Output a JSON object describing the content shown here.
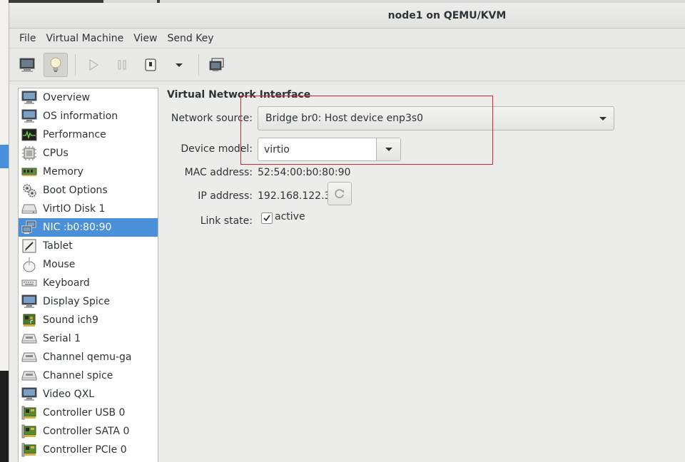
{
  "window": {
    "title": "node1 on QEMU/KVM"
  },
  "menubar": {
    "items": [
      "File",
      "Virtual Machine",
      "View",
      "Send Key"
    ]
  },
  "toolbar": {
    "buttons": [
      {
        "name": "console-icon",
        "active": false,
        "disabled": false
      },
      {
        "name": "details-icon",
        "active": true,
        "disabled": false
      },
      {
        "name": "run-icon",
        "active": false,
        "disabled": true
      },
      {
        "name": "pause-icon",
        "active": false,
        "disabled": true
      },
      {
        "name": "shutdown-icon",
        "active": false,
        "disabled": false
      },
      {
        "name": "shutdown-menu-icon",
        "active": false,
        "disabled": false
      },
      {
        "name": "fullscreen-icon",
        "active": false,
        "disabled": false
      }
    ]
  },
  "sidebar": {
    "items": [
      {
        "label": "Overview",
        "icon": "monitor-icon"
      },
      {
        "label": "OS information",
        "icon": "monitor-icon"
      },
      {
        "label": "Performance",
        "icon": "graph-icon"
      },
      {
        "label": "CPUs",
        "icon": "cpu-icon"
      },
      {
        "label": "Memory",
        "icon": "memory-icon"
      },
      {
        "label": "Boot Options",
        "icon": "gear-icon"
      },
      {
        "label": "VirtIO Disk 1",
        "icon": "disk-icon"
      },
      {
        "label": "NIC :b0:80:90",
        "icon": "network-icon",
        "selected": true
      },
      {
        "label": "Tablet",
        "icon": "tablet-icon"
      },
      {
        "label": "Mouse",
        "icon": "mouse-icon"
      },
      {
        "label": "Keyboard",
        "icon": "keyboard-icon"
      },
      {
        "label": "Display Spice",
        "icon": "monitor-icon"
      },
      {
        "label": "Sound ich9",
        "icon": "sound-card-icon"
      },
      {
        "label": "Serial 1",
        "icon": "serial-icon"
      },
      {
        "label": "Channel qemu-ga",
        "icon": "serial-icon"
      },
      {
        "label": "Channel spice",
        "icon": "serial-icon"
      },
      {
        "label": "Video QXL",
        "icon": "monitor-icon"
      },
      {
        "label": "Controller USB 0",
        "icon": "pci-card-icon"
      },
      {
        "label": "Controller SATA 0",
        "icon": "pci-card-icon"
      },
      {
        "label": "Controller PCIe 0",
        "icon": "pci-card-icon"
      }
    ]
  },
  "details": {
    "section_title": "Virtual Network Interface",
    "network_source_label": "Network source:",
    "network_source_value": "Bridge br0: Host device enp3s0",
    "device_model_label": "Device model:",
    "device_model_value": "virtio",
    "mac_label": "MAC address:",
    "mac_value": "52:54:00:b0:80:90",
    "ip_label": "IP address:",
    "ip_value": "192.168.122.3",
    "link_state_label": "Link state:",
    "link_state_value": "active",
    "link_state_checked": true
  },
  "colors": {
    "selection": "#4a90d9",
    "annotation_box": "#e0262a"
  }
}
